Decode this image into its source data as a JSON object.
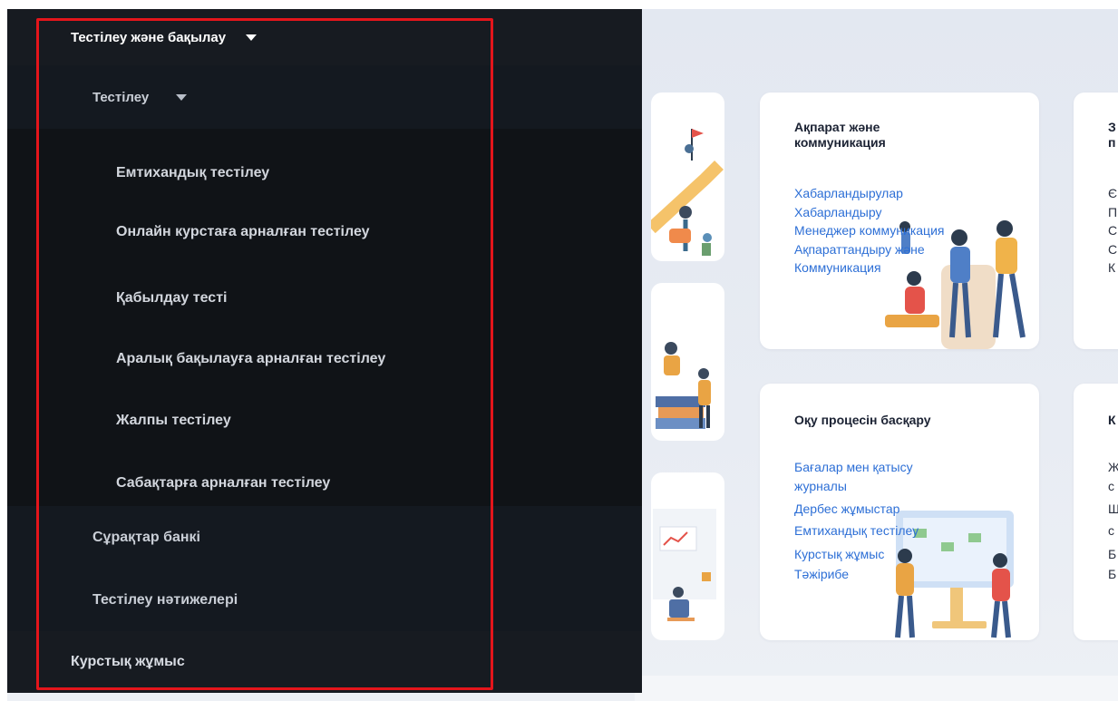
{
  "sidebar": {
    "section_title": "Тестілеу және бақылау",
    "subsection_title": "Тестілеу",
    "submenu_items": [
      "Емтихандық тестілеу",
      "Онлайн курстаға арналған тестілеу",
      "Қабылдау тесті",
      "Аралық бақылауға арналған тестілеу",
      "Жалпы тестілеу",
      "Сабақтарға арналған тестілеу"
    ],
    "question_bank": "Сұрақтар банкі",
    "test_results": "Тестілеу нәтижелері",
    "coursework": "Курстық жұмыс"
  },
  "cards": {
    "info": {
      "title_line1": "Ақпарат және",
      "title_line2": "коммуникация",
      "links": [
        "Хабарландырулар",
        "Хабарландыру",
        "Менеджер коммуникация",
        "Ақпараттандыру және",
        "Коммуникация"
      ]
    },
    "learning": {
      "title": "Оқу процесін басқару",
      "links": [
        "Бағалар мен қатысу",
        "журналы",
        "Дербес жұмыстар",
        "Емтихандық тестілеу",
        "Курстық жұмыс",
        "Тәжірибе"
      ]
    },
    "partial_top": {
      "title_fragment_1": "З",
      "title_fragment_2": "п",
      "link_fragments": [
        "Є",
        "П",
        "С",
        "С",
        "К"
      ]
    },
    "partial_bottom": {
      "title_fragment": "К",
      "link_fragments": [
        "Ж",
        "с",
        "Ш",
        "с",
        "Б",
        "Б"
      ]
    }
  },
  "colors": {
    "sidebar_bg": "#171b21",
    "submenu_bg": "#101317",
    "link_blue": "#2d6fd6",
    "highlight_red": "#e4151b",
    "page_bg": "#e3e8f1"
  },
  "icons": {
    "section_caret": "caret-down-icon",
    "subsection_caret": "caret-down-icon"
  }
}
